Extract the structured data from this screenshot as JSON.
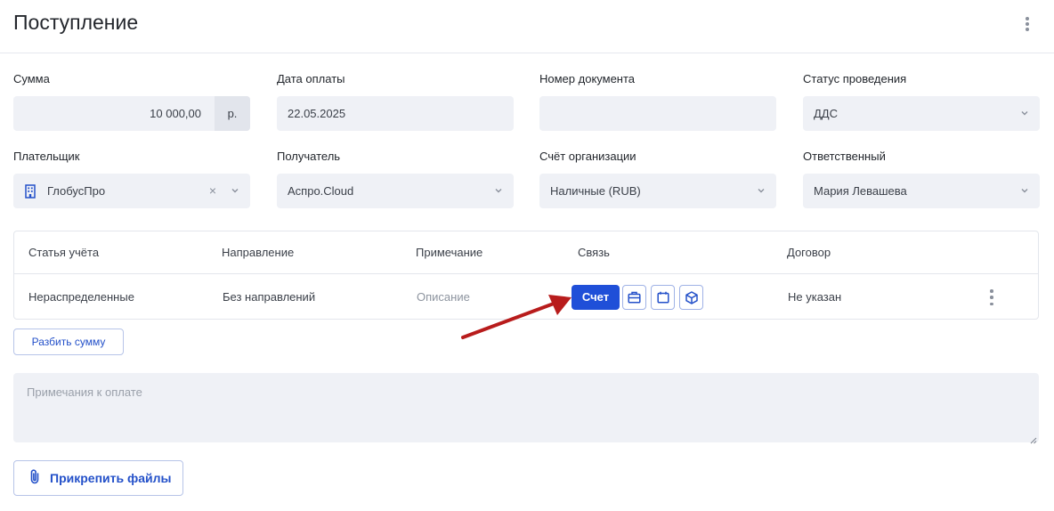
{
  "header": {
    "title": "Поступление"
  },
  "fields": {
    "sum": {
      "label": "Сумма",
      "value": "10 000,00",
      "unit": "р."
    },
    "date": {
      "label": "Дата оплаты",
      "value": "22.05.2025"
    },
    "doc_number": {
      "label": "Номер документа",
      "value": ""
    },
    "status": {
      "label": "Статус проведения",
      "value": "ДДС"
    },
    "payer": {
      "label": "Плательщик",
      "value": "ГлобусПро"
    },
    "recipient": {
      "label": "Получатель",
      "value": "Аспро.Cloud"
    },
    "account": {
      "label": "Счёт организации",
      "value": "Наличные (RUB)"
    },
    "responsible": {
      "label": "Ответственный",
      "value": "Мария Левашева"
    }
  },
  "table": {
    "columns": [
      "Статья учёта",
      "Направление",
      "Примечание",
      "Связь",
      "Договор"
    ],
    "row": {
      "article": "Нераспределенные",
      "direction": "Без направлений",
      "note_placeholder": "Описание",
      "link_button": "Счет",
      "contract": "Не указан"
    }
  },
  "buttons": {
    "split": "Разбить сумму",
    "attach": "Прикрепить файлы"
  },
  "notes": {
    "placeholder": "Примечания к оплате"
  },
  "colors": {
    "accent": "#1f4fd8",
    "field_bg": "#eff1f6",
    "arrow": "#b81c1c"
  }
}
